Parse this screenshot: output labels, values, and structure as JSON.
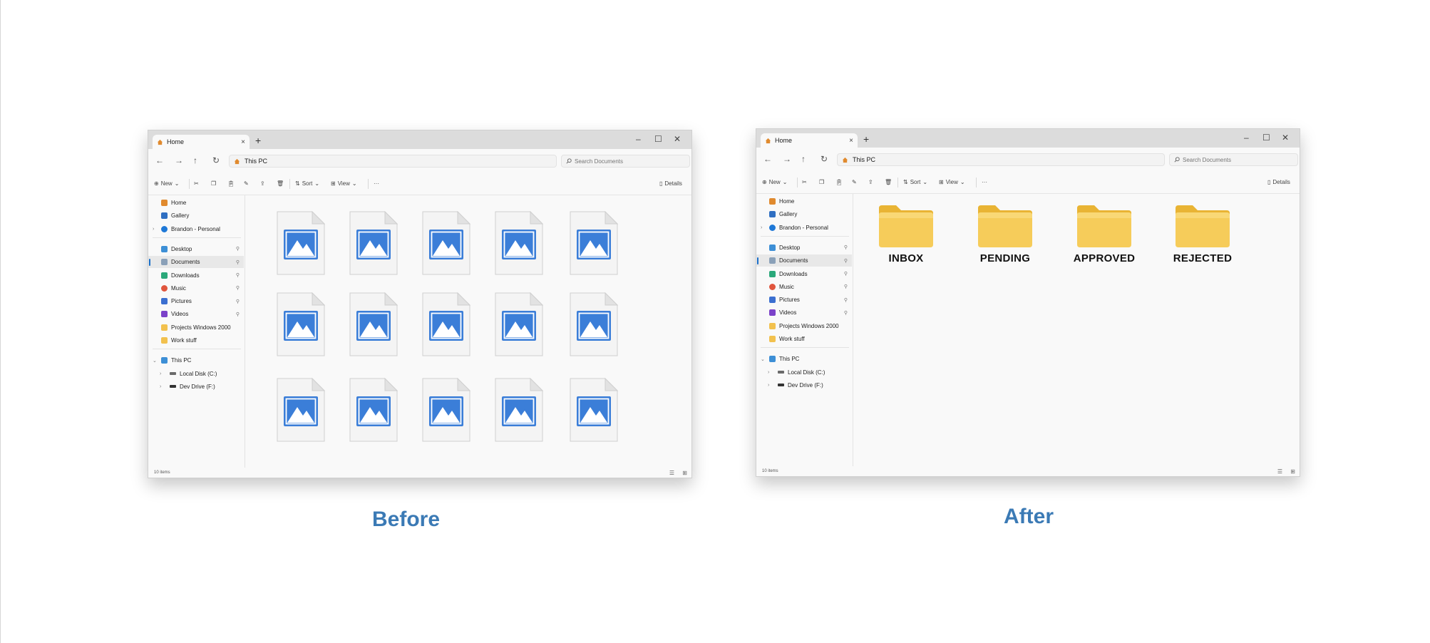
{
  "panels": {
    "before": {
      "caption": "Before"
    },
    "after": {
      "caption": "After"
    }
  },
  "window": {
    "tab_title": "Home",
    "address": "This PC",
    "search_placeholder": "Search Documents",
    "toolbar": {
      "new_label": "New",
      "sort_label": "Sort",
      "view_label": "View",
      "details_label": "Details",
      "more_label": "···"
    },
    "status": "10 items",
    "sidebar": {
      "group1": [
        {
          "label": "Home",
          "icon": "home-icon",
          "color": "#e08a2e"
        },
        {
          "label": "Gallery",
          "icon": "gallery-icon",
          "color": "#2f6fc2"
        },
        {
          "label": "Brandon - Personal",
          "icon": "cloud-icon",
          "color": "#1e78d7"
        }
      ],
      "group2": [
        {
          "label": "Desktop",
          "icon": "desktop-icon",
          "color": "#3d8fd6"
        },
        {
          "label": "Documents",
          "icon": "documents-icon",
          "color": "#8aa0b8"
        },
        {
          "label": "Downloads",
          "icon": "downloads-icon",
          "color": "#2aa87a"
        },
        {
          "label": "Music",
          "icon": "music-icon",
          "color": "#e0553d"
        },
        {
          "label": "Pictures",
          "icon": "pictures-icon",
          "color": "#3b6fd0"
        },
        {
          "label": "Videos",
          "icon": "videos-icon",
          "color": "#7b42c9"
        },
        {
          "label": "Projects Windows 2000",
          "icon": "folder-icon",
          "color": "#f2c14e"
        },
        {
          "label": "Work stuff",
          "icon": "folder-icon",
          "color": "#f2c14e"
        }
      ],
      "group3": [
        {
          "label": "This PC",
          "icon": "computer-icon",
          "color": "#3d8fd6"
        },
        {
          "label": "Local Disk (C:)",
          "icon": "drive-icon",
          "color": "#6a6a6a"
        },
        {
          "label": "Dev Drive (F:)",
          "icon": "drive-icon",
          "color": "#333333"
        }
      ]
    }
  },
  "before_files_count": 15,
  "after_folders": [
    {
      "label": "INBOX"
    },
    {
      "label": "PENDING"
    },
    {
      "label": "APPROVED"
    },
    {
      "label": "REJECTED"
    }
  ],
  "colors": {
    "accent": "#1a6fc9",
    "caption": "#3b7ab5",
    "folder": "#f6cc5a",
    "image_icon": "#3b7ed8"
  }
}
